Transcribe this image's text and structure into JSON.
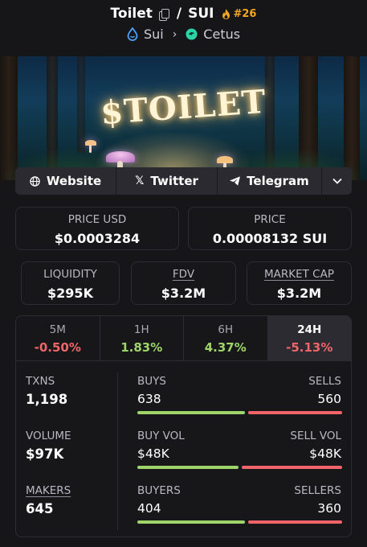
{
  "header": {
    "token_name": "Toilet",
    "quote": "SUI",
    "rank": "#26",
    "chain": "Sui",
    "dex": "Cetus",
    "icons": [
      "copy-icon",
      "fire-icon",
      "sui-chain-icon",
      "chevron-right-icon",
      "cetus-dex-icon"
    ]
  },
  "banner": {
    "text": "$TOILET"
  },
  "links": {
    "website": "Website",
    "twitter": "Twitter",
    "telegram": "Telegram"
  },
  "prices": {
    "price_usd_label": "PRICE USD",
    "price_usd": "$0.0003284",
    "price_label": "PRICE",
    "price": "0.00008132 SUI"
  },
  "metrics": {
    "liquidity_label": "LIQUIDITY",
    "liquidity": "$295K",
    "fdv_label": "FDV",
    "fdv": "$3.2M",
    "mcap_label": "MARKET CAP",
    "mcap": "$3.2M"
  },
  "timeframes": [
    {
      "label": "5M",
      "change": "-0.50%"
    },
    {
      "label": "1H",
      "change": "1.83%"
    },
    {
      "label": "6H",
      "change": "4.37%"
    },
    {
      "label": "24H",
      "change": "-5.13%"
    }
  ],
  "stats": {
    "txns_label": "TXNS",
    "txns": "1,198",
    "buys_label": "BUYS",
    "buys": "638",
    "sells_label": "SELLS",
    "sells": "560",
    "volume_label": "VOLUME",
    "volume": "$97K",
    "buy_vol_label": "BUY VOL",
    "buy_vol": "$48K",
    "sell_vol_label": "SELL VOL",
    "sell_vol": "$48K",
    "makers_label": "MAKERS",
    "makers": "645",
    "buyers_label": "BUYERS",
    "buyers": "404",
    "sellers_label": "SELLERS",
    "sellers": "360"
  },
  "colors": {
    "positive": "#9fd46b",
    "negative": "#f0656a",
    "rank": "#f5a623",
    "background": "#161619"
  }
}
